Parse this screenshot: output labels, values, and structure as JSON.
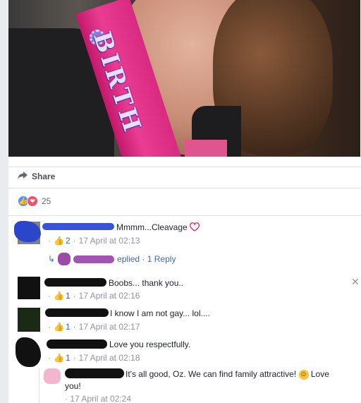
{
  "share": {
    "label": "Share",
    "icon": "share-arrow-icon"
  },
  "reactions": {
    "count": "25",
    "like_icon": "thumbs-up-icon",
    "love_icon": "heart-icon",
    "like_color": "#5890ff",
    "love_color": "#f25268"
  },
  "photo": {
    "sash_text": "BIRTH"
  },
  "comments": [
    {
      "text": "Mmmm...Cleavage",
      "likes": "2",
      "time": "17 April at 02:13"
    },
    {
      "text": "Boobs... thank you..",
      "likes": "1",
      "time": "17 April at 02:16"
    },
    {
      "text": "I know I am not gay... lol....",
      "likes": "1",
      "time": "17 April at 02:17"
    },
    {
      "text": "Love you respectfully.",
      "likes": "1",
      "time": "17 April at 02:18"
    }
  ],
  "reply_summary": {
    "text": "eplied · 1 Reply"
  },
  "reply": {
    "text_a": "It's all good, Oz. We can find family attractive!",
    "text_b": "Love",
    "text_c": "you!",
    "time": "· 17 April at 02:24"
  },
  "separator": "·",
  "accent": "#4267b2"
}
